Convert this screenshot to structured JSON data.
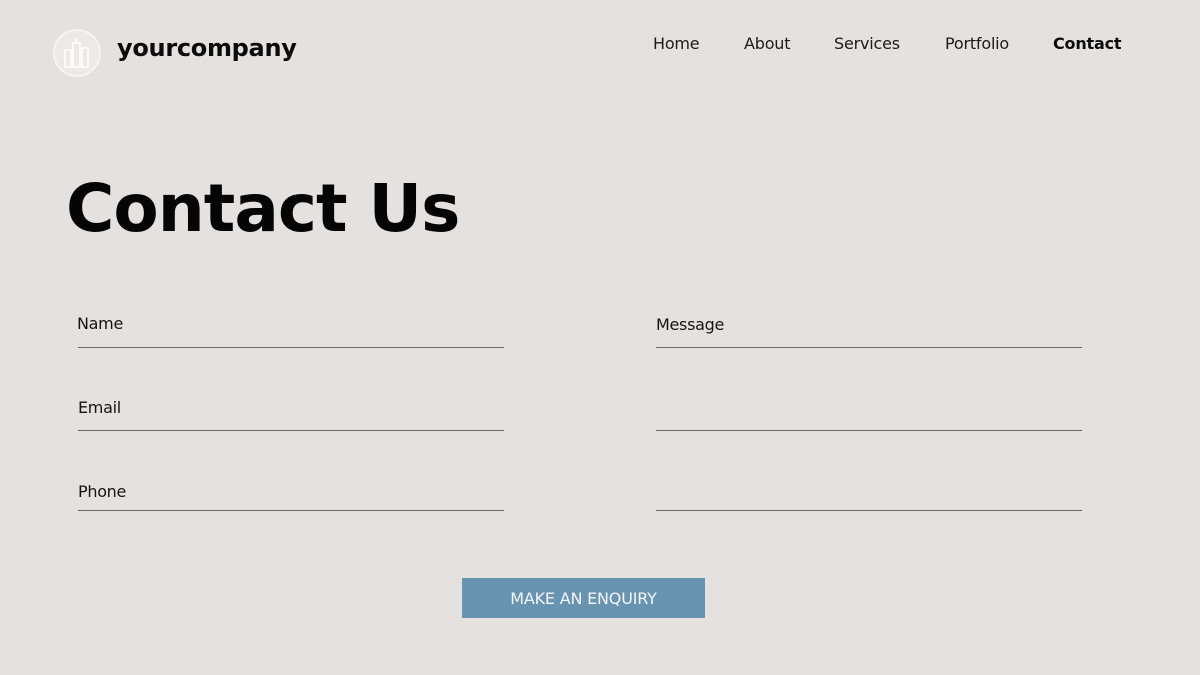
{
  "header": {
    "logo_icon": "building-skyline-icon",
    "brand": "yourcompany"
  },
  "nav": {
    "items": [
      {
        "label": "Home",
        "active": false
      },
      {
        "label": "About",
        "active": false
      },
      {
        "label": "Services",
        "active": false
      },
      {
        "label": "Portfolio",
        "active": false
      },
      {
        "label": "Contact",
        "active": true
      }
    ]
  },
  "main": {
    "title": "Contact Us",
    "form": {
      "name_label": "Name",
      "email_label": "Email",
      "phone_label": "Phone",
      "message_label": "Message",
      "name_value": "",
      "email_value": "",
      "phone_value": "",
      "message_value": "",
      "submit_label": "MAKE AN ENQUIRY"
    }
  },
  "colors": {
    "background": "#e5e1de",
    "button": "#6893b1",
    "underline": "#6b6866"
  }
}
